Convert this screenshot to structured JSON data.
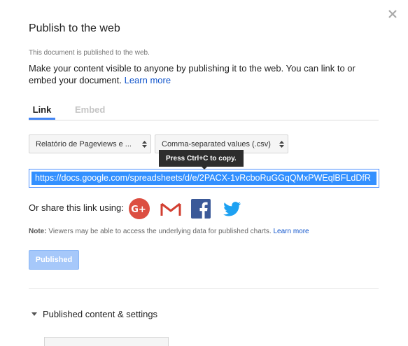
{
  "dialog": {
    "title": "Publish to the web",
    "status_text": "This document is published to the web.",
    "description": "Make your content visible to anyone by publishing it to the web. You can link to or embed your document.",
    "learn_more": "Learn more"
  },
  "tabs": {
    "link": "Link",
    "embed": "Embed"
  },
  "selects": {
    "sheet_value": "Relatório de Pageviews e ...",
    "format_value": "Comma-separated values (.csv)"
  },
  "tooltip": "Press Ctrl+C to copy.",
  "url": "https://docs.google.com/spreadsheets/d/e/2PACX-1vRcboRuGGqQMxPWEqlBFLdDfR",
  "share": {
    "label": "Or share this link using:"
  },
  "note": {
    "label": "Note:",
    "text": "Viewers may be able to access the underlying data for published charts.",
    "learn_more": "Learn more"
  },
  "published_button": "Published",
  "section": {
    "label": "Published content & settings"
  },
  "colors": {
    "accent": "#4285f4",
    "link": "#1155cc",
    "selection": "#3390ff",
    "published_btn": "#a6c8fa"
  },
  "icons": [
    "close-icon",
    "google-plus-icon",
    "gmail-icon",
    "facebook-icon",
    "twitter-icon",
    "dropdown-arrows-icon",
    "triangle-down-icon"
  ]
}
